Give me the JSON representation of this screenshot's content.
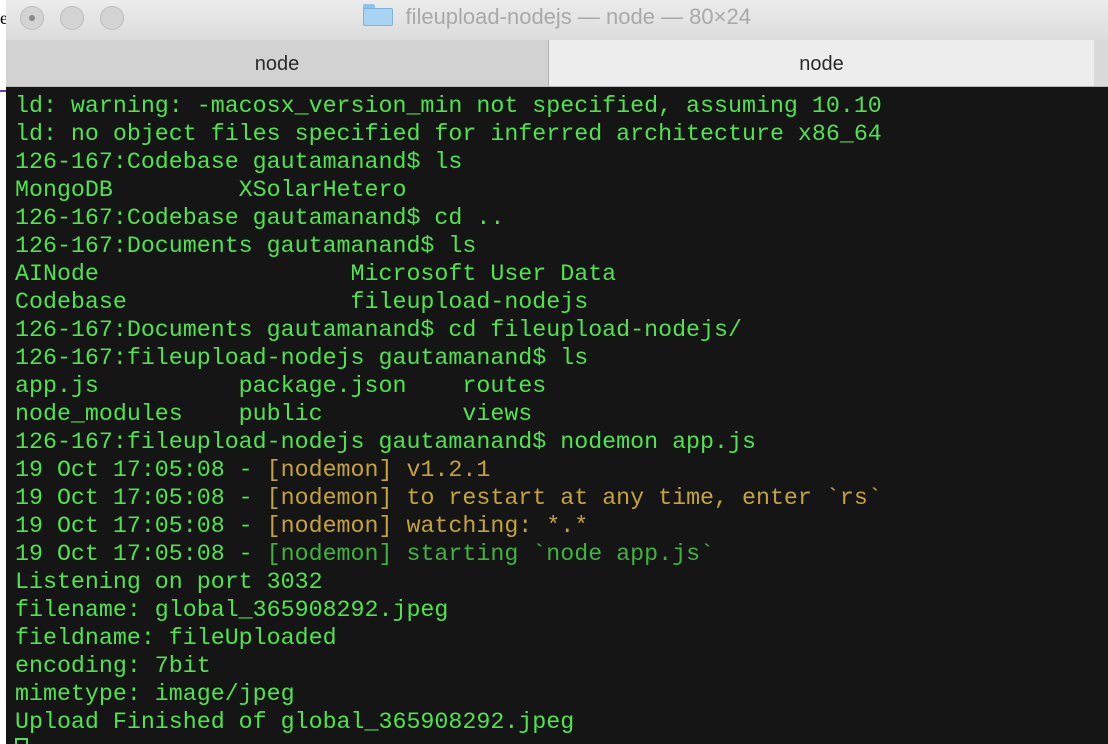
{
  "background": {
    "letter": "e"
  },
  "window": {
    "title": "fileupload-nodejs — node — 80×24"
  },
  "tabs": [
    {
      "label": "node",
      "active": false
    },
    {
      "label": "node",
      "active": true
    }
  ],
  "colors": {
    "terminal_bg": "#151515",
    "text_green": "#4fe34f",
    "nodemon_yellow": "#c4a43a",
    "nodemon_green": "#3fb33f"
  },
  "terminal": {
    "lines": [
      "ld: warning: -macosx_version_min not specified, assuming 10.10",
      "ld: no object files specified for inferred architecture x86_64",
      "126-167:Codebase gautamanand$ ls",
      "MongoDB         XSolarHetero",
      "126-167:Codebase gautamanand$ cd ..",
      "126-167:Documents gautamanand$ ls",
      "AINode                  Microsoft User Data",
      "Codebase                fileupload-nodejs",
      "126-167:Documents gautamanand$ cd fileupload-nodejs/",
      "126-167:fileupload-nodejs gautamanand$ ls",
      "app.js          package.json    routes",
      "node_modules    public          views",
      "126-167:fileupload-nodejs gautamanand$ nodemon app.js"
    ],
    "nodemon": [
      {
        "prefix": "19 Oct 17:05:08 - ",
        "tag": "[nodemon]",
        "msg": " v1.2.1"
      },
      {
        "prefix": "19 Oct 17:05:08 - ",
        "tag": "[nodemon]",
        "msg": " to restart at any time, enter `rs`"
      },
      {
        "prefix": "19 Oct 17:05:08 - ",
        "tag": "[nodemon]",
        "msg": " watching: *.*"
      },
      {
        "prefix": "19 Oct 17:05:08 - ",
        "tag": "[nodemon]",
        "msg": " starting `node app.js`"
      }
    ],
    "output": [
      "Listening on port 3032",
      "filename: global_365908292.jpeg",
      "fieldname: fileUploaded",
      "encoding: 7bit",
      "mimetype: image/jpeg",
      "Upload Finished of global_365908292.jpeg"
    ]
  }
}
